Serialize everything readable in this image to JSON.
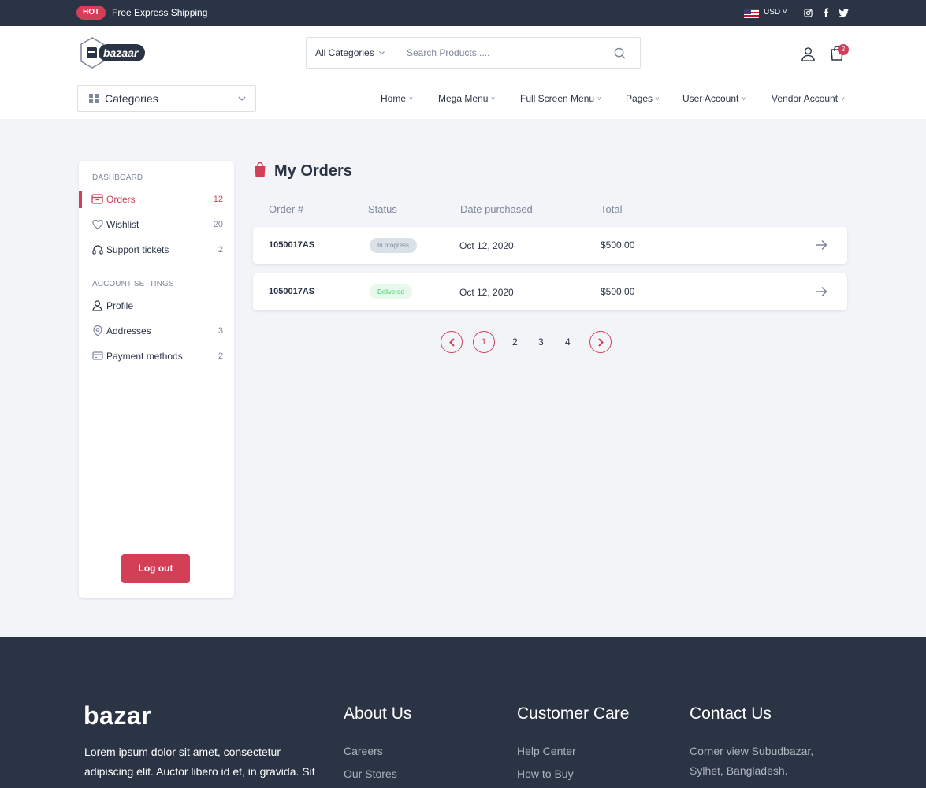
{
  "topbar": {
    "badge": "HOT",
    "shipping": "Free Express Shipping",
    "currency": "USD",
    "icons": [
      "us-flag-icon",
      "instagram-icon",
      "facebook-icon",
      "twitter-icon"
    ]
  },
  "header": {
    "logo_text": "bazaar",
    "search": {
      "category": "All Categories",
      "placeholder": "Search Products....."
    },
    "cart_count": "2",
    "categories_label": "Categories",
    "nav": [
      "Home",
      "Mega Menu",
      "Full Screen Menu",
      "Pages",
      "User Account",
      "Vendor Account"
    ]
  },
  "sidebar": {
    "dashboard_title": "DASHBOARD",
    "dashboard_items": [
      {
        "label": "Orders",
        "count": "12"
      },
      {
        "label": "Wishlist",
        "count": "20"
      },
      {
        "label": "Support tickets",
        "count": "2"
      }
    ],
    "account_title": "ACCOUNT SETTINGS",
    "account_items": [
      {
        "label": "Profile",
        "count": ""
      },
      {
        "label": "Addresses",
        "count": "3"
      },
      {
        "label": "Payment methods",
        "count": "2"
      }
    ],
    "logout": "Log out"
  },
  "main": {
    "title": "My Orders",
    "columns": [
      "Order #",
      "Status",
      "Date purchased",
      "Total"
    ],
    "orders": [
      {
        "id": "1050017AS",
        "status": "In progress",
        "date": "Oct 12, 2020",
        "total": "$500.00"
      },
      {
        "id": "1050017AS",
        "status": "Delivered",
        "date": "Oct 12, 2020",
        "total": "$500.00"
      }
    ],
    "pagination": {
      "current": "1",
      "pages": [
        "2",
        "3",
        "4"
      ]
    }
  },
  "footer": {
    "logo_text": "bazar",
    "description": "Lorem ipsum dolor sit amet, consectetur adipiscing elit. Auctor libero id et, in gravida. Sit",
    "about": {
      "title": "About Us",
      "links": [
        "Careers",
        "Our Stores"
      ]
    },
    "care": {
      "title": "Customer Care",
      "links": [
        "Help Center",
        "How to Buy"
      ]
    },
    "contact": {
      "title": "Contact Us",
      "lines": [
        "Corner view Subudbazar,",
        "Sylhet, Bangladesh."
      ]
    }
  },
  "colors": {
    "primary": "#d23f57",
    "dark": "#2b3445",
    "muted": "#7d879c",
    "background": "#f2f4f8",
    "delivered": "#33d067"
  }
}
